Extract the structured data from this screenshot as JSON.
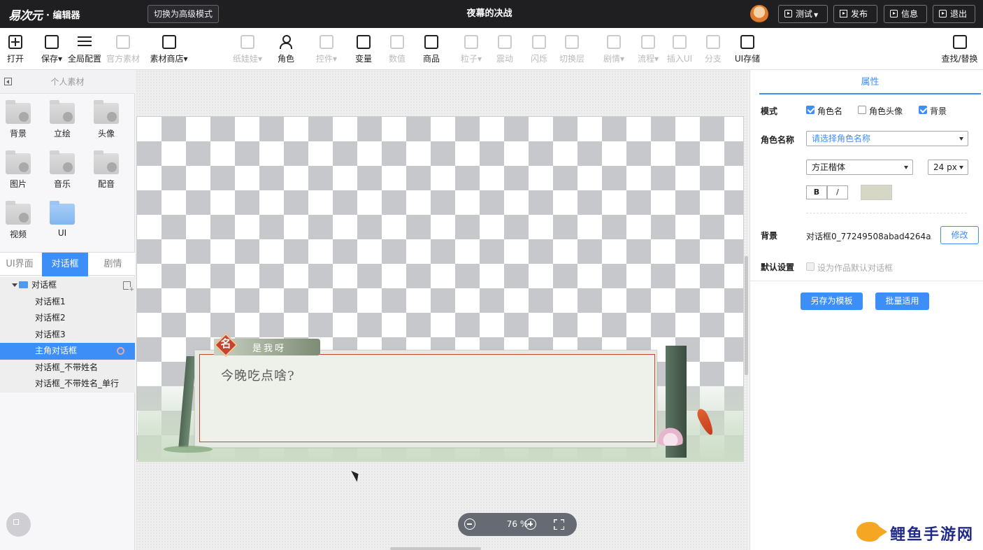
{
  "app": {
    "logo_text": "易次元",
    "logo_suffix": "· 编辑器",
    "advanced_mode_button": "切换为高级模式",
    "project_title": "夜幕的决战"
  },
  "top_actions": [
    {
      "label": "测试",
      "icon": "play-icon",
      "has_dropdown": true
    },
    {
      "label": "发布",
      "icon": "share-icon",
      "has_dropdown": false
    },
    {
      "label": "信息",
      "icon": "edit-icon",
      "has_dropdown": false
    },
    {
      "label": "退出",
      "icon": "logout-icon",
      "has_dropdown": false
    }
  ],
  "toolbar": {
    "open": "打开",
    "save": "保存",
    "global_config": "全局配置",
    "official_assets": "官方素材",
    "asset_store": "素材商店",
    "paper_doll": "纸娃娃",
    "character": "角色",
    "widget": "控件",
    "variable": "变量",
    "value": "数值",
    "goods": "商品",
    "particle": "粒子",
    "shake": "震动",
    "flash": "闪烁",
    "switch_layer": "切换层",
    "plot": "剧情",
    "flow": "流程",
    "insert_ui": "插入UI",
    "branch": "分支",
    "ui_storage": "UI存储",
    "find_replace": "查找/替换"
  },
  "left_panel": {
    "title": "个人素材",
    "assets": [
      "背景",
      "立绘",
      "头像",
      "图片",
      "音乐",
      "配音",
      "视频",
      "UI"
    ],
    "tabs": [
      "UI界面",
      "对话框",
      "剧情"
    ],
    "active_tab": "对话框",
    "tree": {
      "folder": "对话框",
      "items": [
        "对话框1",
        "对话框2",
        "对话框3",
        "主角对话框",
        "对话框_不带姓名",
        "对话框_不带姓名_单行"
      ],
      "selected": "主角对话框"
    }
  },
  "canvas": {
    "name_badge": "名",
    "speaker_name": "是我呀",
    "dialog_text": "今晚吃点啥?",
    "zoom": "76 %"
  },
  "properties": {
    "tab": "属性",
    "mode_label": "模式",
    "mode_options": [
      {
        "label": "角色名",
        "checked": true
      },
      {
        "label": "角色头像",
        "checked": false
      },
      {
        "label": "背景",
        "checked": true
      }
    ],
    "char_name_label": "角色名称",
    "char_name_placeholder": "请选择角色名称",
    "font_family": "方正楷体",
    "font_size": "24 px",
    "bold": "B",
    "italic": "/",
    "text_color": "#d6d7c4",
    "bg_label": "背景",
    "bg_value": "对话框0_77249508abad4264a...",
    "edit_button": "修改",
    "default_label": "默认设置",
    "default_checkbox": "设为作品默认对话框",
    "save_template": "另存为模板",
    "batch_apply": "批量适用"
  },
  "watermark": "鲤鱼手游网",
  "colors": {
    "accent": "#3e8ef7",
    "topbar": "#1f1f22",
    "dialog_border": "#c6442e"
  }
}
